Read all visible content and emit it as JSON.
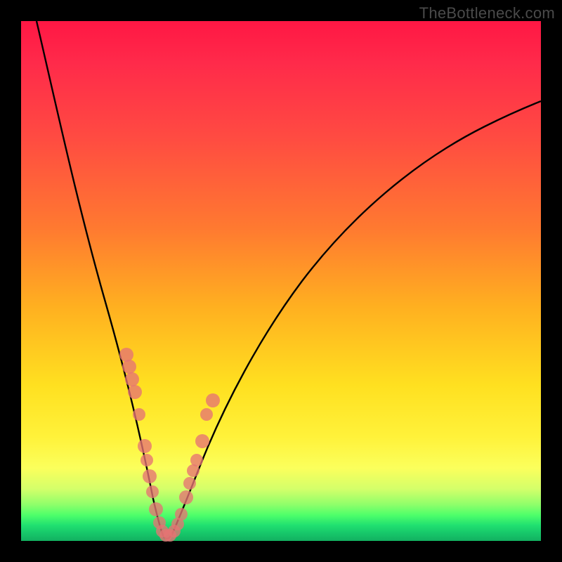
{
  "watermark": "TheBottleneck.com",
  "colors": {
    "gradient_top": "#ff1744",
    "gradient_mid1": "#ff7a30",
    "gradient_mid2": "#ffe020",
    "gradient_bottom": "#12b060",
    "curve": "#000000",
    "dot": "#e57373",
    "frame": "#000000"
  },
  "chart_data": {
    "type": "line",
    "title": "",
    "xlabel": "",
    "ylabel": "",
    "xlim": [
      0,
      100
    ],
    "ylim": [
      0,
      100
    ],
    "note": "Axes are unlabeled in the image; values are normalized 0–100. The curve is a V-shaped bottleneck plot reaching ~0 near x≈27. Scatter points cluster along the lower part of the V.",
    "series": [
      {
        "name": "curve",
        "x": [
          3,
          5,
          8,
          10,
          12,
          14,
          16,
          18,
          20,
          22,
          24,
          25,
          26,
          27,
          28,
          29,
          30,
          32,
          34,
          36,
          38,
          40,
          44,
          48,
          52,
          56,
          60,
          65,
          70,
          75,
          80,
          85,
          90,
          95,
          100
        ],
        "y": [
          100,
          90,
          78,
          70,
          62,
          55,
          48,
          41,
          34,
          27,
          18,
          12,
          6,
          1,
          1,
          4,
          8,
          14,
          20,
          25,
          30,
          34,
          42,
          48,
          54,
          58,
          62,
          67,
          71,
          74,
          77,
          79.5,
          81.5,
          83.3,
          85
        ]
      },
      {
        "name": "points",
        "x": [
          18,
          18.7,
          19.4,
          20.1,
          21.2,
          22.3,
          22.8,
          23.4,
          24.0,
          24.8,
          25.5,
          26.2,
          26.8,
          27.3,
          27.9,
          28.4,
          29.0,
          29.8,
          30.6,
          31.3,
          31.9,
          33.0,
          34.8,
          34.2
        ],
        "y": [
          36.5,
          34.0,
          31.5,
          29.0,
          24.0,
          17.5,
          15.0,
          12.0,
          9.0,
          5.5,
          3.0,
          1.5,
          1.0,
          1.0,
          1.5,
          3.0,
          5.0,
          8.5,
          11.5,
          14.0,
          16.0,
          20.0,
          27.5,
          25.0
        ]
      }
    ]
  }
}
